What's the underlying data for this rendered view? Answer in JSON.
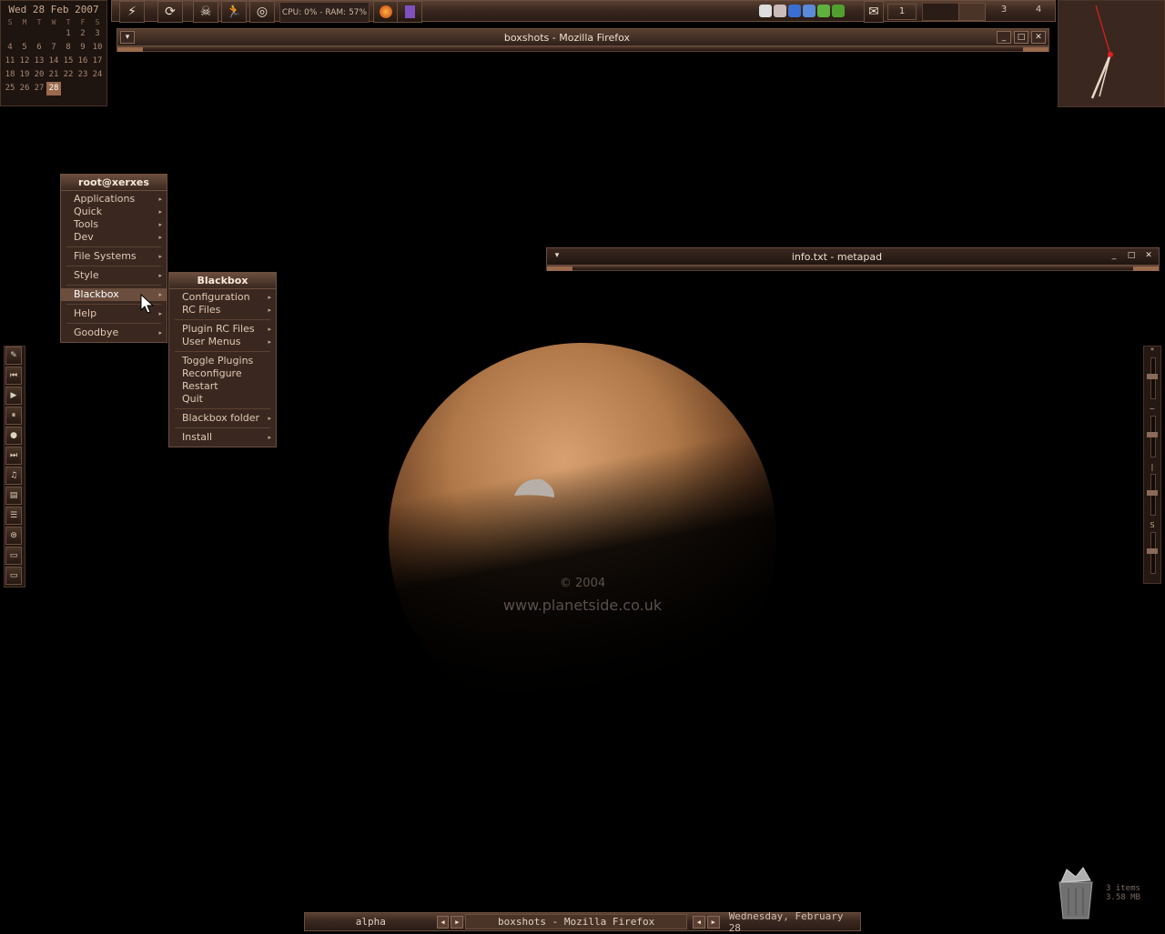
{
  "calendar": {
    "title": "Wed 28 Feb 2007",
    "weekdays": [
      "S",
      "M",
      "T",
      "W",
      "T",
      "F",
      "S"
    ],
    "rows": [
      [
        "",
        "",
        "",
        "",
        "1",
        "2",
        "3"
      ],
      [
        "4",
        "5",
        "6",
        "7",
        "8",
        "9",
        "10"
      ],
      [
        "11",
        "12",
        "13",
        "14",
        "15",
        "16",
        "17"
      ],
      [
        "18",
        "19",
        "20",
        "21",
        "22",
        "23",
        "24"
      ],
      [
        "25",
        "26",
        "27",
        "28",
        "",
        "",
        ""
      ]
    ],
    "today": "28"
  },
  "toolbar": {
    "launch_icons": [
      "run-icon",
      "refresh-icon",
      "skull-icon",
      "runner-icon",
      "network-icon"
    ],
    "status_text": "CPU: 0% - RAM: 57%",
    "mail_count": "1",
    "workspaces": [
      "3",
      "4"
    ]
  },
  "firefox_window": {
    "title": "boxshots - Mozilla Firefox"
  },
  "metapad_window": {
    "title": "info.txt - metapad"
  },
  "root_menu": {
    "title": "root@xerxes",
    "groups": [
      [
        "Applications",
        "Quick",
        "Tools",
        "Dev"
      ],
      [
        "File Systems"
      ],
      [
        "Style"
      ],
      [
        "Blackbox"
      ],
      [
        "Help"
      ],
      [
        "Goodbye"
      ]
    ],
    "selected": "Blackbox"
  },
  "blackbox_menu": {
    "title": "Blackbox",
    "groups": [
      [
        {
          "label": "Configuration",
          "sub": true
        },
        {
          "label": "RC Files",
          "sub": true
        }
      ],
      [
        {
          "label": "Plugin RC Files",
          "sub": true
        },
        {
          "label": "User Menus",
          "sub": true
        }
      ],
      [
        {
          "label": "Toggle Plugins",
          "sub": false
        },
        {
          "label": "Reconfigure",
          "sub": false
        },
        {
          "label": "Restart",
          "sub": false
        },
        {
          "label": "Quit",
          "sub": false
        }
      ],
      [
        {
          "label": "Blackbox folder",
          "sub": true
        }
      ],
      [
        {
          "label": "Install",
          "sub": true
        }
      ]
    ]
  },
  "wallpaper": {
    "copyright": "© 2004",
    "site": "www.planetside.co.uk"
  },
  "recycle": {
    "items": "3 items",
    "size": "3.58 MB"
  },
  "bottombar": {
    "workspace": "alpha",
    "task": "boxshots - Mozilla Firefox",
    "date": "Wednesday, February 28"
  },
  "media_buttons": [
    "pen-icon",
    "prev-icon",
    "play-icon",
    "pause-icon",
    "stop-icon",
    "next-icon",
    "music-icon",
    "list-icon",
    "mixer-icon",
    "disk-icon",
    "monitor-icon",
    "display-icon"
  ],
  "mixer_labels": [
    "*",
    "~",
    "|",
    "S"
  ]
}
